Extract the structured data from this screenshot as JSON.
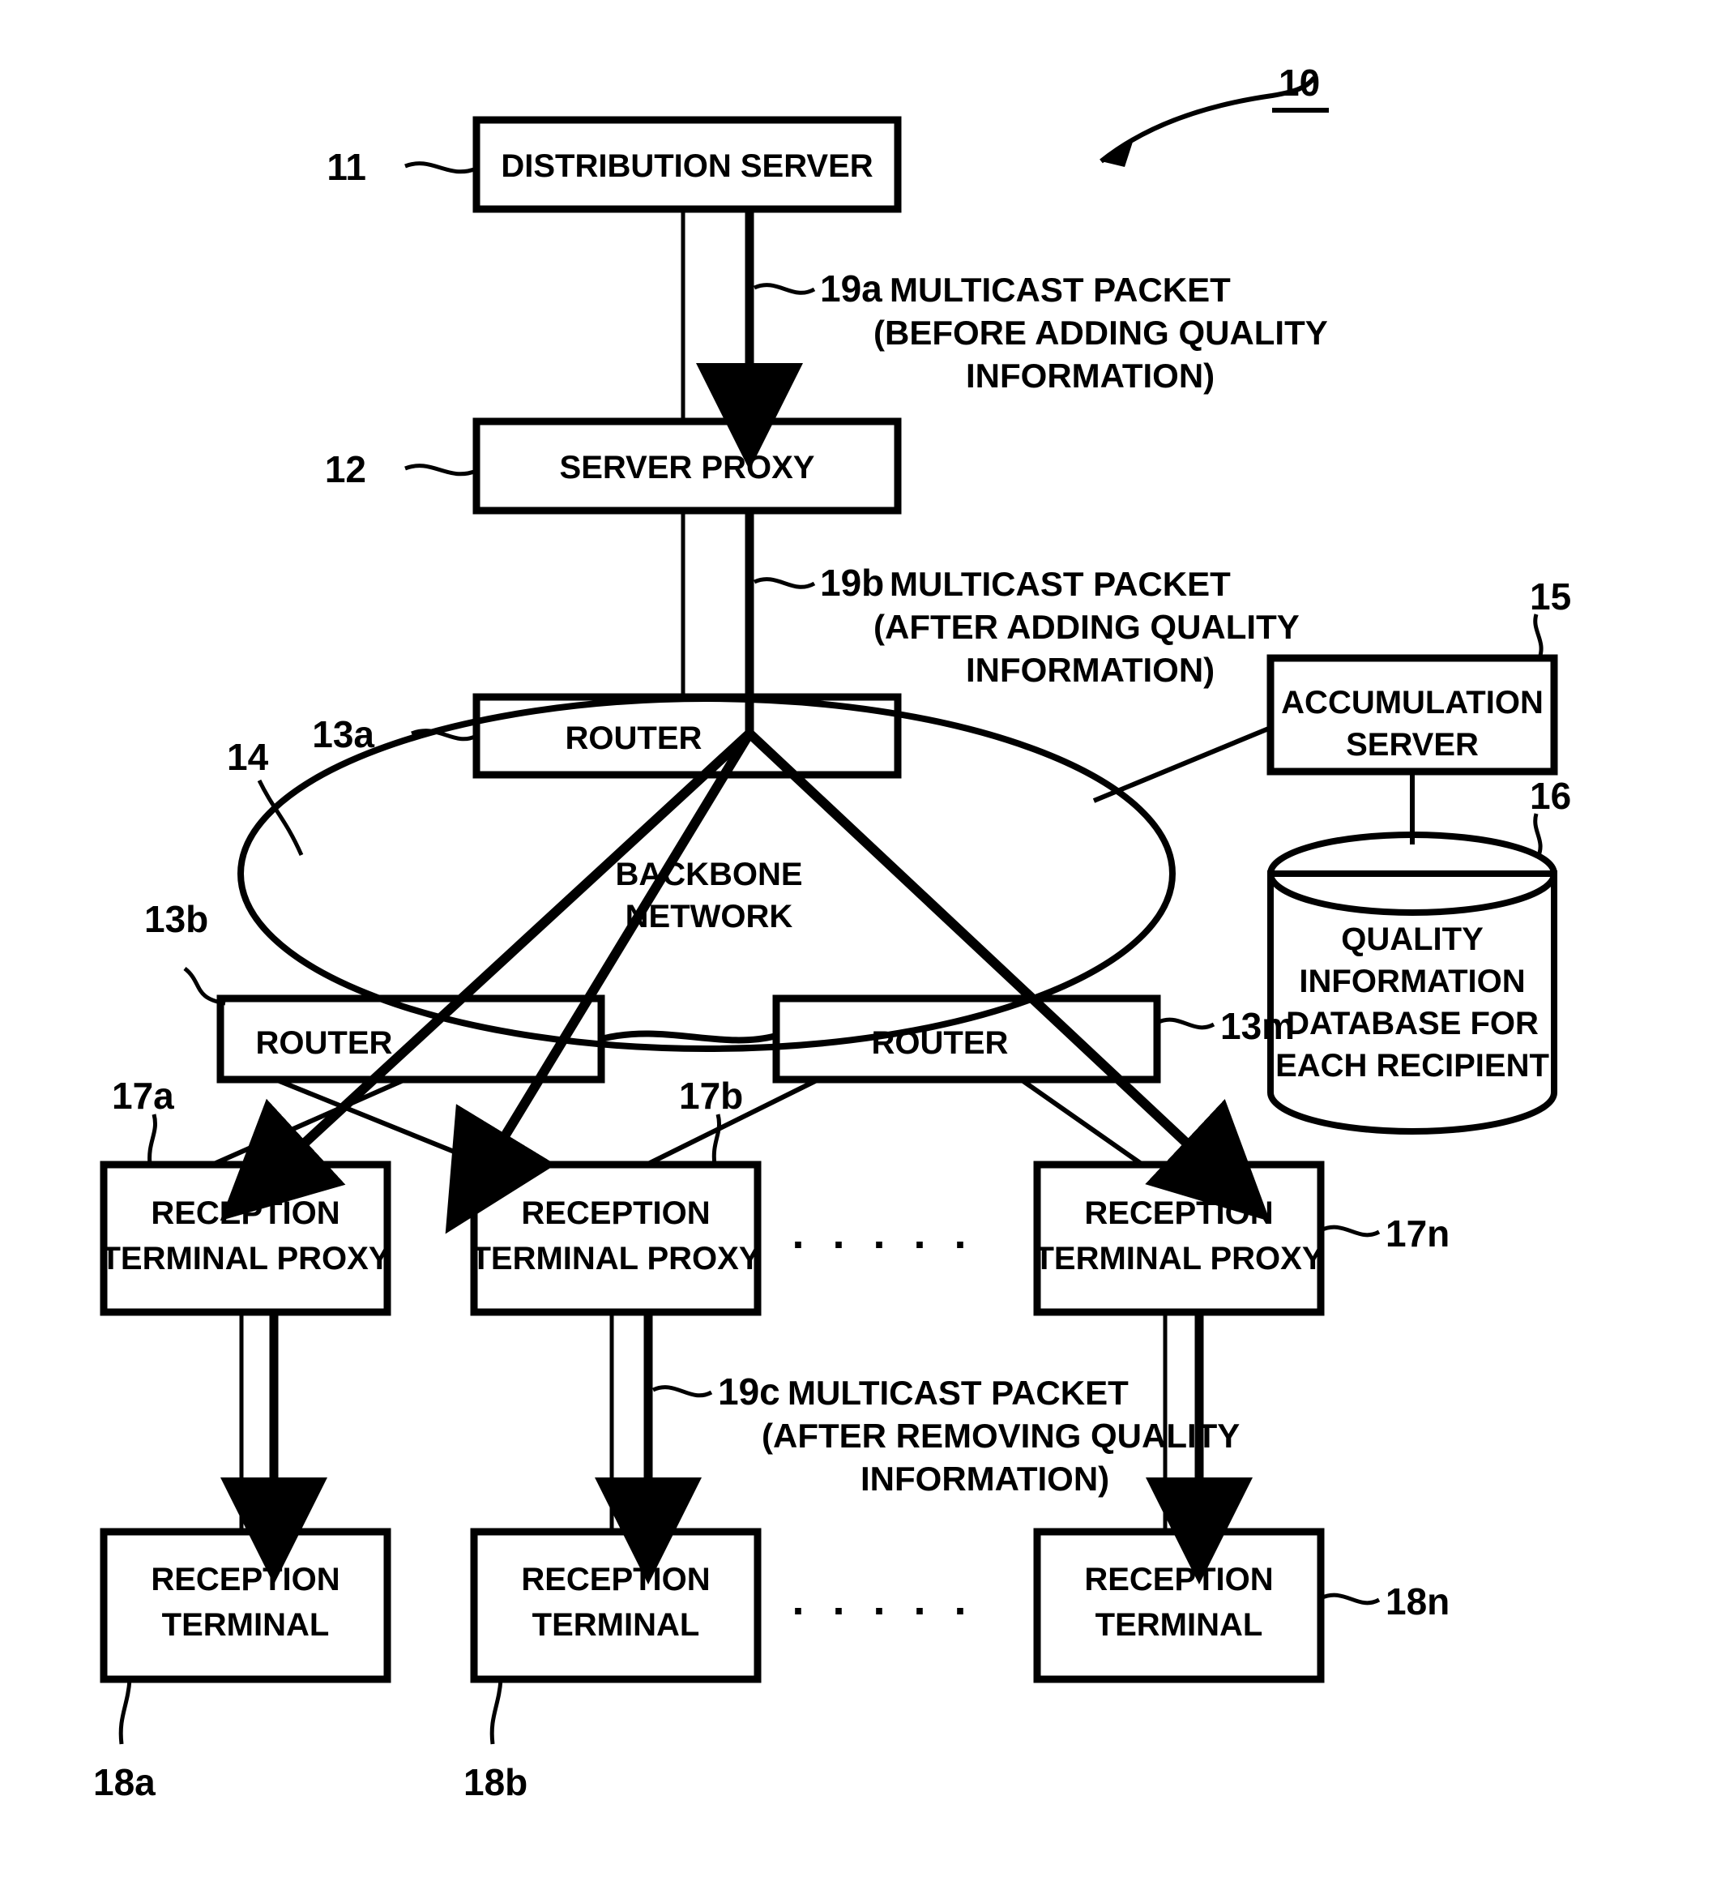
{
  "figure": {
    "reference_numeral": "10",
    "nodes": {
      "distribution_server": {
        "ref": "11",
        "label": "DISTRIBUTION SERVER"
      },
      "server_proxy": {
        "ref": "12",
        "label": "SERVER PROXY"
      },
      "router_top": {
        "ref": "13a",
        "label": "ROUTER"
      },
      "router_left": {
        "ref": "13b",
        "label": "ROUTER"
      },
      "router_right": {
        "ref": "13m",
        "label": "ROUTER"
      },
      "backbone_network": {
        "ref": "14",
        "label_line1": "BACKBONE",
        "label_line2": "NETWORK"
      },
      "accumulation_server": {
        "ref": "15",
        "label_line1": "ACCUMULATION",
        "label_line2": "SERVER"
      },
      "quality_database": {
        "ref": "16",
        "label_line1": "QUALITY",
        "label_line2": "INFORMATION",
        "label_line3": "DATABASE FOR",
        "label_line4": "EACH RECIPIENT"
      },
      "reception_terminal_proxy_a": {
        "ref": "17a",
        "label_line1": "RECEPTION",
        "label_line2": "TERMINAL PROXY"
      },
      "reception_terminal_proxy_b": {
        "ref": "17b",
        "label_line1": "RECEPTION",
        "label_line2": "TERMINAL PROXY"
      },
      "reception_terminal_proxy_n": {
        "ref": "17n",
        "label_line1": "RECEPTION",
        "label_line2": "TERMINAL PROXY"
      },
      "reception_terminal_a": {
        "ref": "18a",
        "label_line1": "RECEPTION",
        "label_line2": "TERMINAL"
      },
      "reception_terminal_b": {
        "ref": "18b",
        "label_line1": "RECEPTION",
        "label_line2": "TERMINAL"
      },
      "reception_terminal_n": {
        "ref": "18n",
        "label_line1": "RECEPTION",
        "label_line2": "TERMINAL"
      }
    },
    "annotations": {
      "packet_before": {
        "ref": "19a",
        "line1": "MULTICAST PACKET",
        "line2": "(BEFORE ADDING QUALITY",
        "line3": "INFORMATION)"
      },
      "packet_after": {
        "ref": "19b",
        "line1": "MULTICAST PACKET",
        "line2": "(AFTER ADDING QUALITY",
        "line3": "INFORMATION)"
      },
      "packet_removed": {
        "ref": "19c",
        "line1": "MULTICAST PACKET",
        "line2": "(AFTER REMOVING QUALITY",
        "line3": "INFORMATION)"
      }
    },
    "ellipsis": {
      "proxy_row": ". . . . .",
      "terminal_row": ". . . . ."
    },
    "colors": {
      "ink": "#000000",
      "paper": "#ffffff"
    }
  }
}
